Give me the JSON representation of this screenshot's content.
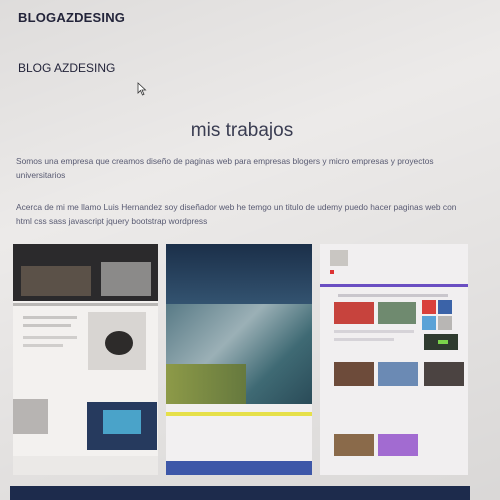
{
  "header": {
    "brand": "BLOGAZDESING",
    "blog_name": "BLOG AZDESING"
  },
  "main": {
    "title": "mis trabajos",
    "intro": "Somos una empresa que creamos diseño de paginas web para empresas blogers y micro empresas y proyectos universitarios",
    "about": "Acerca de mi me llamo Luis Hernandez soy diseñador web he temgo un titulo de udemy puedo hacer paginas web con html css sass javascript jquery bootstrap wordpress"
  },
  "colors": {
    "page_background": "#eceae9",
    "text": "#585a72",
    "dark_navy": "#1d2b4c",
    "yellow_bar": "#e6e04a",
    "blue_bar": "#3d57a8"
  },
  "icons": {
    "cursor": "mouse-pointer-icon"
  }
}
